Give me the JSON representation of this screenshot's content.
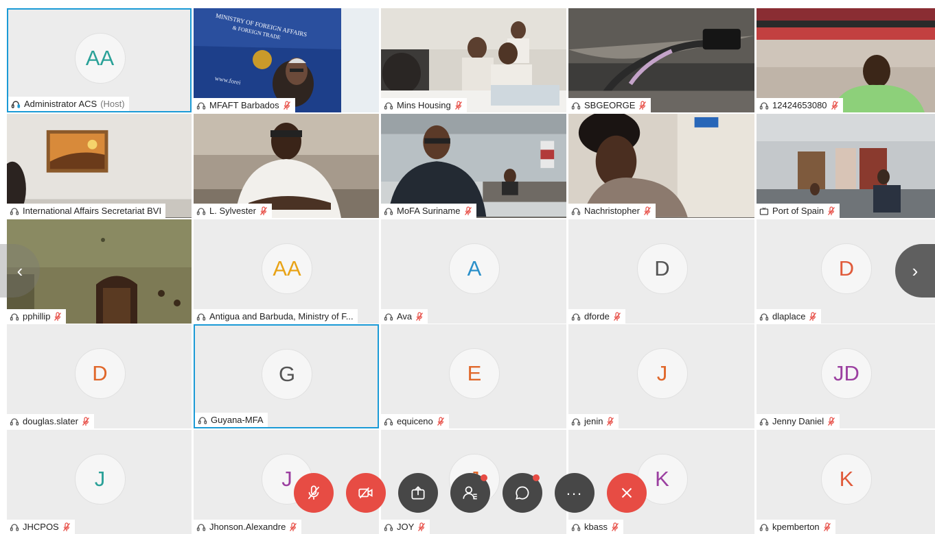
{
  "participants": [
    {
      "name": "Administrator ACS",
      "role": "(Host)",
      "initials": "AA",
      "initial_color": "#2aa198",
      "type": "avatar",
      "audio": "connected",
      "muted": false,
      "selected": true,
      "scene": ""
    },
    {
      "name": "MFAFT Barbados",
      "initials": "",
      "type": "video",
      "muted": true,
      "scene": "office-sign",
      "sign_line1": "MINISTRY OF FOREIGN AFFAIRS",
      "sign_line2": "& FOREIGN TRADE",
      "sign_url": "www.forei"
    },
    {
      "name": "Mins Housing",
      "initials": "",
      "type": "video",
      "muted": true,
      "scene": "meeting-room"
    },
    {
      "name": "SBGEORGE",
      "initials": "",
      "type": "video",
      "muted": true,
      "scene": "desk-cable"
    },
    {
      "name": "12424653080",
      "initials": "",
      "type": "video",
      "muted": true,
      "scene": "person-green"
    },
    {
      "name": "International Affairs Secretariat BVI",
      "initials": "",
      "type": "video",
      "muted": false,
      "scene": "wall-painting"
    },
    {
      "name": "L. Sylvester",
      "initials": "",
      "type": "video",
      "muted": true,
      "scene": "person-white-shirt"
    },
    {
      "name": "MoFA Suriname",
      "initials": "",
      "type": "video",
      "muted": true,
      "scene": "conference-table"
    },
    {
      "name": "Nachristopher",
      "initials": "",
      "type": "video",
      "muted": true,
      "scene": "person-reading"
    },
    {
      "name": "Port of Spain",
      "initials": "",
      "type": "video",
      "muted": true,
      "device": "tv",
      "scene": "office-corridor"
    },
    {
      "name": "pphillip",
      "initials": "",
      "type": "video",
      "muted": true,
      "scene": "ceiling-room"
    },
    {
      "name": "Antigua and Barbuda, Ministry of F...",
      "initials": "AA",
      "initial_color": "#e8a317",
      "type": "avatar",
      "muted": false
    },
    {
      "name": "Ava",
      "initials": "A",
      "initial_color": "#2a8fc9",
      "type": "avatar",
      "muted": true
    },
    {
      "name": "dforde",
      "initials": "D",
      "initial_color": "#555555",
      "type": "avatar",
      "muted": true
    },
    {
      "name": "dlaplace",
      "initials": "D",
      "initial_color": "#e05a3a",
      "type": "avatar",
      "muted": true
    },
    {
      "name": "douglas.slater",
      "initials": "D",
      "initial_color": "#e0672a",
      "type": "avatar",
      "muted": true
    },
    {
      "name": "Guyana-MFA",
      "initials": "G",
      "initial_color": "#555555",
      "type": "avatar",
      "muted": false,
      "selected": true
    },
    {
      "name": "equiceno",
      "initials": "E",
      "initial_color": "#e0672a",
      "type": "avatar",
      "muted": true
    },
    {
      "name": "jenin",
      "initials": "J",
      "initial_color": "#e0672a",
      "type": "avatar",
      "muted": true
    },
    {
      "name": "Jenny Daniel",
      "initials": "JD",
      "initial_color": "#9b3fa0",
      "type": "avatar",
      "muted": true
    },
    {
      "name": "JHCPOS",
      "initials": "J",
      "initial_color": "#2aa198",
      "type": "avatar",
      "muted": true
    },
    {
      "name": "Jhonson.Alexandre",
      "initials": "J",
      "initial_color": "#9b3fa0",
      "type": "avatar",
      "muted": true
    },
    {
      "name": "JOY",
      "initials": "J",
      "initial_color": "#e0672a",
      "type": "avatar",
      "muted": true
    },
    {
      "name": "kbass",
      "initials": "K",
      "initial_color": "#9b3fa0",
      "type": "avatar",
      "muted": true
    },
    {
      "name": "kpemberton",
      "initials": "K",
      "initial_color": "#e05a3a",
      "type": "avatar",
      "muted": true
    }
  ],
  "navigation": {
    "prev": "‹",
    "next": "›"
  },
  "controls": [
    {
      "id": "mute",
      "icon": "mic-off-icon",
      "style": "red"
    },
    {
      "id": "video",
      "icon": "video-off-icon",
      "style": "red"
    },
    {
      "id": "share",
      "icon": "share-icon",
      "style": "dark"
    },
    {
      "id": "participants",
      "icon": "participants-icon",
      "style": "dark",
      "notification": true
    },
    {
      "id": "chat",
      "icon": "chat-icon",
      "style": "dark",
      "notification": true
    },
    {
      "id": "more",
      "icon": "more-icon",
      "style": "dark",
      "text": "..."
    },
    {
      "id": "leave",
      "icon": "close-icon",
      "style": "red"
    }
  ],
  "colors": {
    "accent": "#1a9ad6",
    "danger": "#e74c44",
    "tile_bg": "#ececec",
    "control_dark": "#474747"
  }
}
